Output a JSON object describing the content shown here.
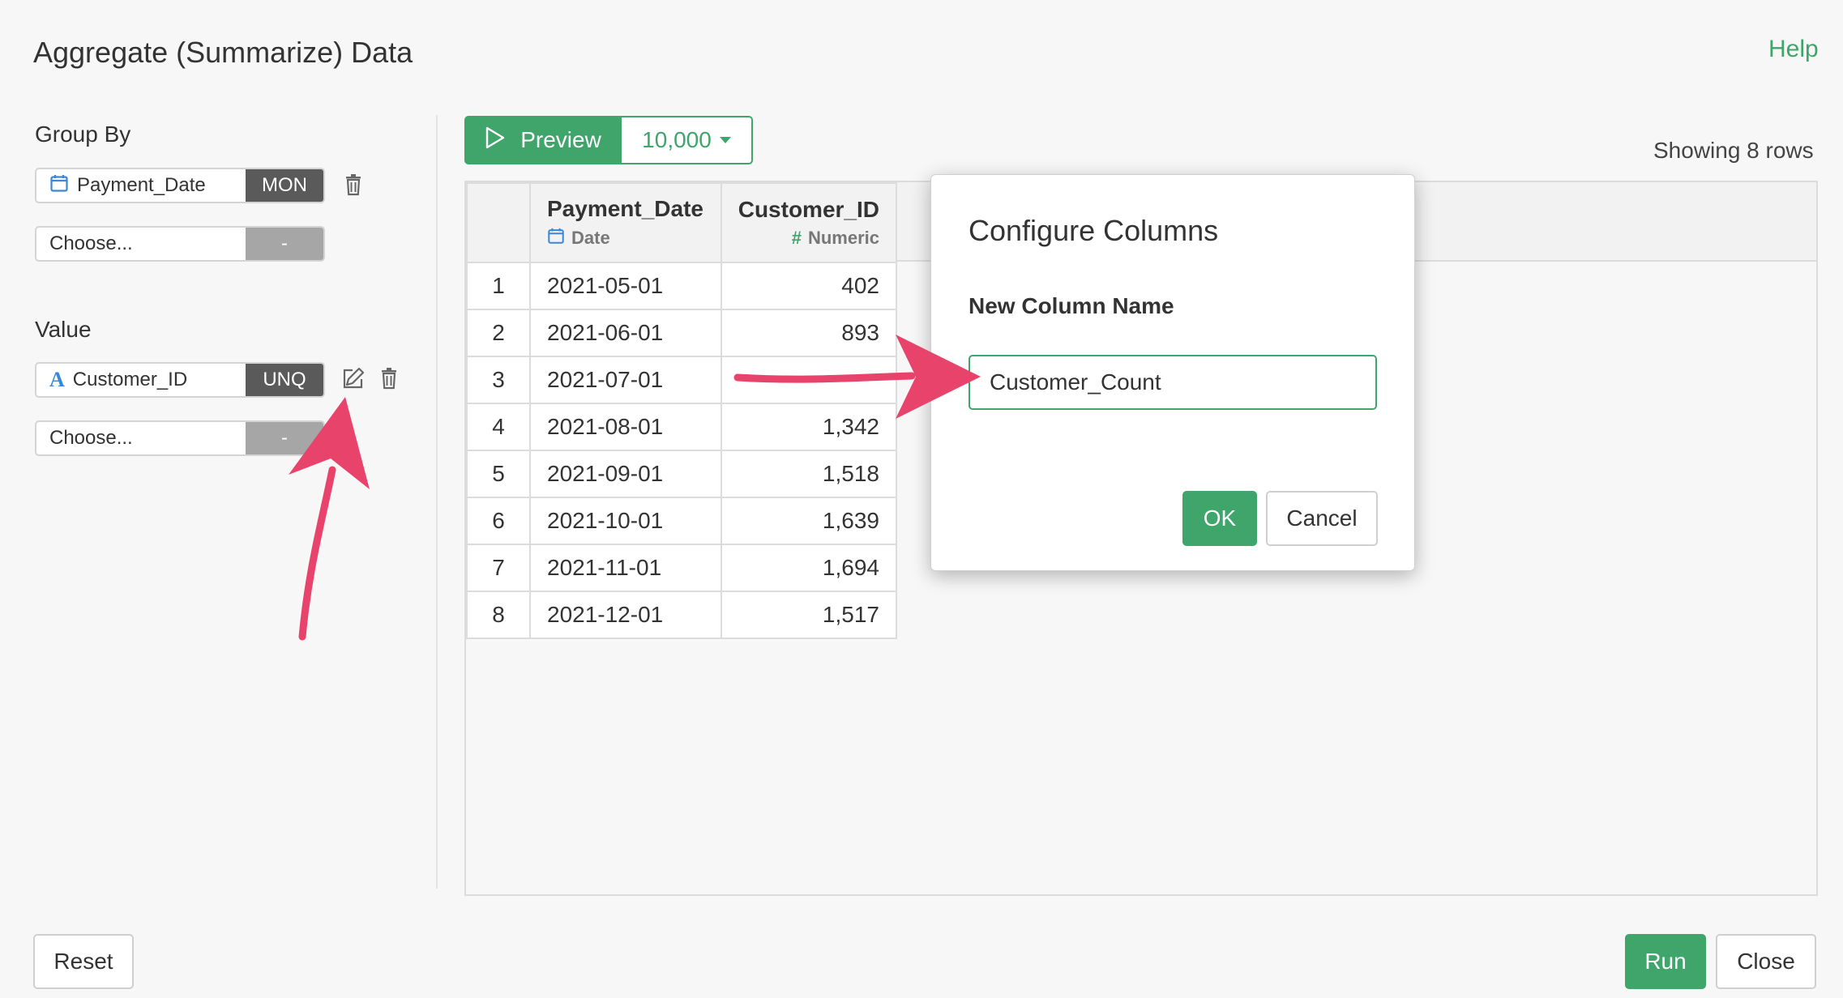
{
  "header": {
    "title": "Aggregate (Summarize) Data",
    "help_label": "Help"
  },
  "group_by": {
    "label": "Group By",
    "items": [
      {
        "column": "Payment_Date",
        "function": "MON",
        "icon": "calendar-icon"
      }
    ],
    "placeholder": {
      "label": "Choose...",
      "function": "-"
    }
  },
  "value": {
    "label": "Value",
    "items": [
      {
        "column": "Customer_ID",
        "function": "UNQ",
        "icon": "character-type-icon",
        "icon_glyph": "A"
      }
    ],
    "placeholder": {
      "label": "Choose...",
      "function": "-"
    }
  },
  "toolbar": {
    "preview_label": "Preview",
    "row_limit": "10,000",
    "showing_text": "Showing 8 rows"
  },
  "table": {
    "columns": [
      {
        "name": "Payment_Date",
        "type": "Date",
        "type_icon": "calendar-icon"
      },
      {
        "name": "Customer_ID",
        "type": "Numeric",
        "type_icon": "hash-icon",
        "type_glyph": "#"
      }
    ],
    "rows": [
      {
        "index": "1",
        "date": "2021-05-01",
        "value": "402"
      },
      {
        "index": "2",
        "date": "2021-06-01",
        "value": "893"
      },
      {
        "index": "3",
        "date": "2021-07-01",
        "value": ""
      },
      {
        "index": "4",
        "date": "2021-08-01",
        "value": "1,342"
      },
      {
        "index": "5",
        "date": "2021-09-01",
        "value": "1,518"
      },
      {
        "index": "6",
        "date": "2021-10-01",
        "value": "1,639"
      },
      {
        "index": "7",
        "date": "2021-11-01",
        "value": "1,694"
      },
      {
        "index": "8",
        "date": "2021-12-01",
        "value": "1,517"
      }
    ]
  },
  "dialog": {
    "title": "Configure Columns",
    "field_label": "New Column Name",
    "field_value": "Customer_Count",
    "ok_label": "OK",
    "cancel_label": "Cancel"
  },
  "footer": {
    "reset_label": "Reset",
    "run_label": "Run",
    "close_label": "Close"
  },
  "colors": {
    "accent": "#3fa56a",
    "annotation_arrow": "#e8436b",
    "tag_dark": "#5a5a5a",
    "tag_light": "#a6a6a6",
    "calendar_icon": "#3a86d8"
  }
}
